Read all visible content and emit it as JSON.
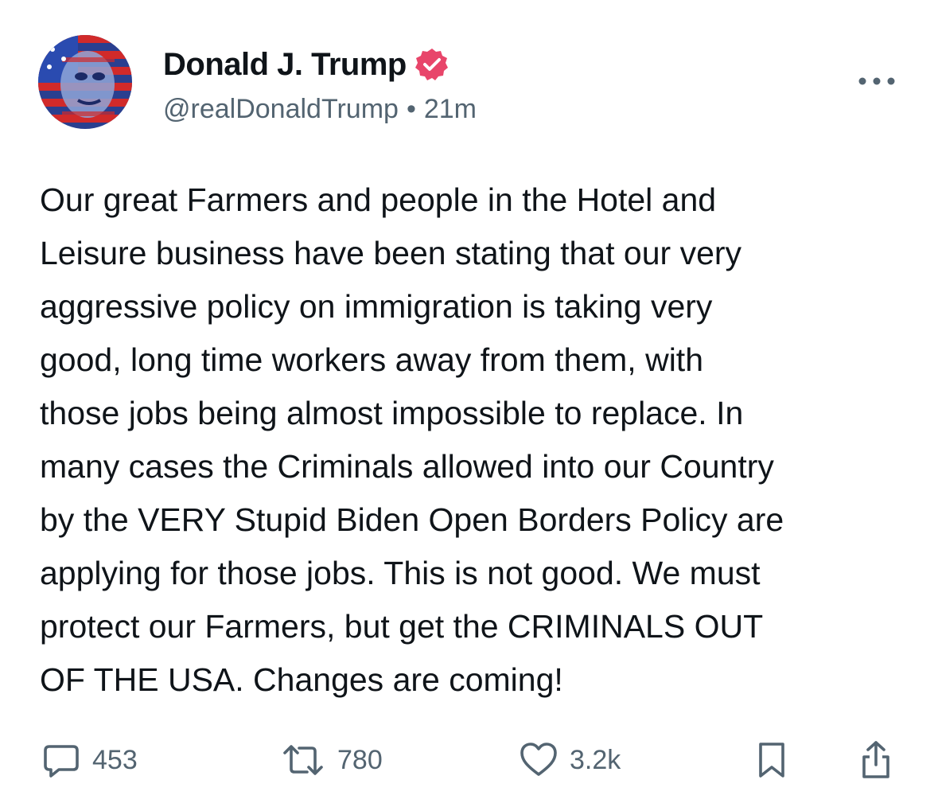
{
  "post": {
    "author": {
      "display_name": "Donald J. Trump",
      "verified": true,
      "verified_badge_icon": "verified-badge-icon",
      "handle": "@realDonaldTrump",
      "separator": "•",
      "timestamp": "21m",
      "avatar_icon": "profile-avatar"
    },
    "more_icon": "more-horizontal-icon",
    "text": "Our great Farmers and people in the Hotel and\nLeisure business have been stating that our very\naggressive policy on immigration is taking very\ngood, long time workers away from them, with\nthose jobs being almost impossible to replace. In\nmany cases the Criminals allowed into our Country\nby the VERY Stupid Biden Open Borders Policy are\napplying for those jobs. This is not good. We must\nprotect our Farmers, but get the CRIMINALS OUT\nOF THE USA. Changes are coming!",
    "actions": {
      "reply": {
        "icon": "reply-icon",
        "count": "453"
      },
      "repost": {
        "icon": "repost-icon",
        "count": "780"
      },
      "like": {
        "icon": "heart-icon",
        "count": "3.2k"
      },
      "bookmark": {
        "icon": "bookmark-icon"
      },
      "share": {
        "icon": "share-icon"
      }
    }
  },
  "colors": {
    "text_primary": "#0f1419",
    "text_secondary": "#536471",
    "verified_badge": "#e8456a",
    "background": "#ffffff"
  }
}
